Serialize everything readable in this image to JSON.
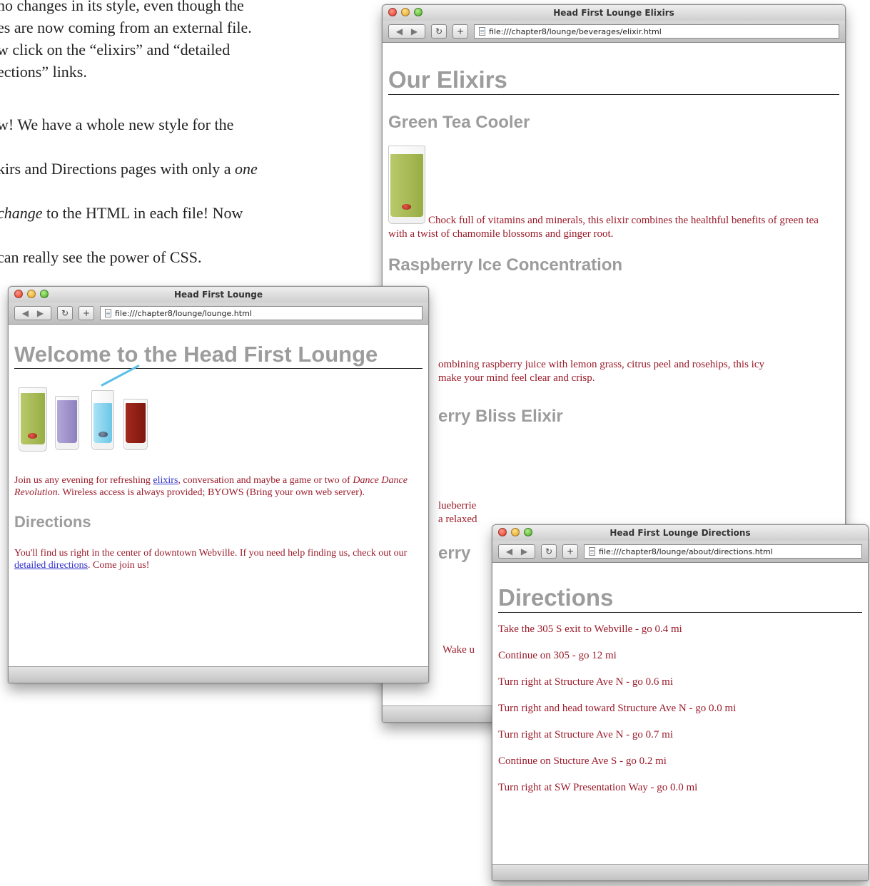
{
  "page_text": {
    "p1": "no changes in its style, even though the\nes are now coming from an external file.\nw click on the “elixirs” and “detailed\nections” links.",
    "p2_a": "w!  We have a whole new style for the",
    "p2_b": "kirs and Directions pages with only a ",
    "p2_b_em": "one",
    "p2_c_em": "change",
    "p2_c": " to the HTML in each file!  Now",
    "p2_d": " can really see the power of CSS."
  },
  "elixir_window": {
    "title": "Head First Lounge Elixirs",
    "url": "file:///chapter8/lounge/beverages/elixir.html",
    "heading": "Our Elixirs",
    "items": [
      {
        "name": "Green Tea Cooler",
        "text": "Chock full of vitamins and minerals, this elixir combines the healthful benefits of green tea with a twist of chamomile blossoms and ginger root."
      },
      {
        "name": "Raspberry Ice Concentration",
        "text_a": "ombining raspberry juice with lemon grass, citrus peel and rosehips, this icy",
        "text_b": "make your mind feel clear and crisp."
      },
      {
        "name": "erry Bliss Elixir",
        "text_a": "lueberrie",
        "text_b": "a relaxed"
      },
      {
        "name": "erry"
      },
      {
        "text": "Wake u"
      }
    ]
  },
  "lounge_window": {
    "title": "Head First Lounge",
    "url": "file:///chapter8/lounge/lounge.html",
    "heading": "Welcome to the Head First Lounge",
    "intro_a": "Join us any evening for refreshing ",
    "intro_link": "elixirs",
    "intro_b": ", conversation and maybe a game or two of ",
    "intro_em": "Dance Dance Revolution",
    "intro_c": ". Wireless access is always provided; BYOWS (Bring your own web server).",
    "directions_heading": "Directions",
    "directions_a": "You'll find us right in the center of downtown Webville. If you need help finding us, check out our ",
    "directions_link": "detailed directions",
    "directions_b": ". Come join us!"
  },
  "directions_window": {
    "title": "Head First Lounge Directions",
    "url": "file:///chapter8/lounge/about/directions.html",
    "heading": "Directions",
    "steps": [
      "Take the 305 S exit to Webville - go 0.4 mi",
      "Continue on 305 - go 12 mi",
      "Turn right at Structure Ave N - go 0.6 mi",
      "Turn right and head toward Structure Ave N - go 0.0 mi",
      "Turn right at Structure Ave N - go 0.7 mi",
      "Continue on Stucture Ave S - go 0.2 mi",
      "Turn right at SW Presentation Way - go 0.0 mi"
    ]
  },
  "colors": {
    "heading_gray": "#9c9c9c",
    "body_red": "#9a1b2a",
    "link_blue": "#3333cc",
    "green_tea": "#a9bd5a",
    "lavender": "#9d8fc9",
    "ice_blue": "#7fd3ee",
    "raspberry": "#8e1d14"
  },
  "icons": [
    "window-close-icon",
    "window-minimize-icon",
    "window-zoom-icon",
    "back-icon",
    "forward-icon",
    "reload-icon",
    "add-bookmark-icon",
    "file-icon"
  ]
}
